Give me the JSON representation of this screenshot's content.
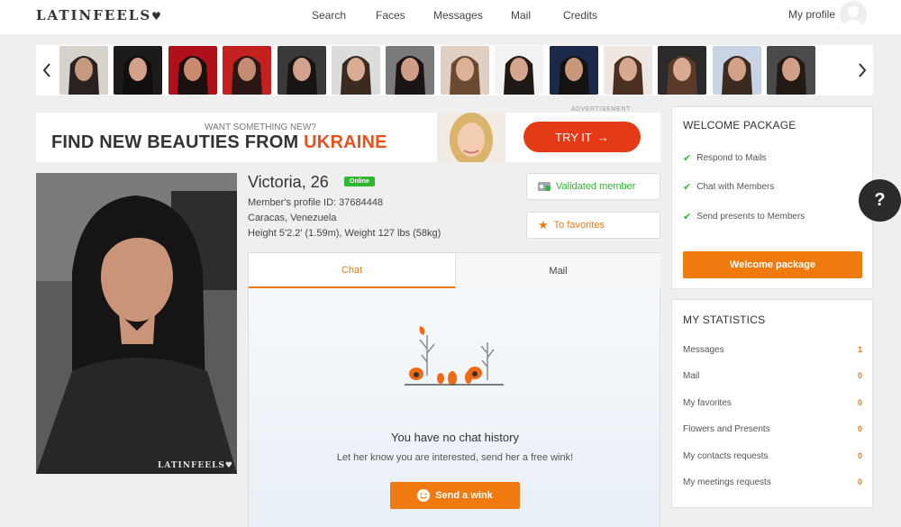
{
  "header": {
    "logo": "LATINFEELS",
    "logo_heart": "♥",
    "nav": [
      {
        "label": "Search"
      },
      {
        "label": "Faces"
      },
      {
        "label": "Messages"
      },
      {
        "label": "Mail"
      },
      {
        "label": "Credits"
      }
    ],
    "profile_label": "My profile"
  },
  "carousel": {
    "prev_icon": "chevron-left-icon",
    "next_icon": "chevron-right-icon",
    "thumb_count": 14
  },
  "ad": {
    "label": "ADVERTISEMENT",
    "small": "WANT SOMETHING NEW?",
    "big_prefix": "FIND NEW BEAUTIES FROM ",
    "big_highlight": "UKRAINE",
    "button": "TRY IT",
    "accent": "#e53a16"
  },
  "profile": {
    "name": "Victoria, 26",
    "status": "Online",
    "id_line": "Member's profile ID: 37684448",
    "location": "Caracas, Venezuela",
    "measurements": "Height 5'2.2' (1.59m), Weight 127 lbs (58kg)",
    "watermark": "LATINFEELS♥",
    "validated": "Validated member",
    "favorites": "To favorites"
  },
  "tabs": [
    {
      "label": "Chat",
      "active": true
    },
    {
      "label": "Mail",
      "active": false
    }
  ],
  "chat": {
    "empty_title": "You have no chat history",
    "empty_sub": "Let her know you are interested, send her a free wink!",
    "wink_button": "Send a wink"
  },
  "welcome": {
    "title": "WELCOME PACKAGE",
    "items": [
      {
        "label": "Respond to Mails"
      },
      {
        "label": "Chat with Members"
      },
      {
        "label": "Send presents to Members"
      }
    ],
    "button": "Welcome package"
  },
  "stats": {
    "title": "MY STATISTICS",
    "rows": [
      {
        "label": "Messages",
        "value": "1"
      },
      {
        "label": "Mail",
        "value": "0"
      },
      {
        "label": "My favorites",
        "value": "0"
      },
      {
        "label": "Flowers and Presents",
        "value": "0"
      },
      {
        "label": "My contacts requests",
        "value": "0"
      },
      {
        "label": "My meetings requests",
        "value": "0"
      }
    ]
  },
  "help": {
    "label": "?"
  },
  "colors": {
    "accent": "#f07a10",
    "online": "#2eb82e",
    "ad_button": "#e53a16"
  }
}
